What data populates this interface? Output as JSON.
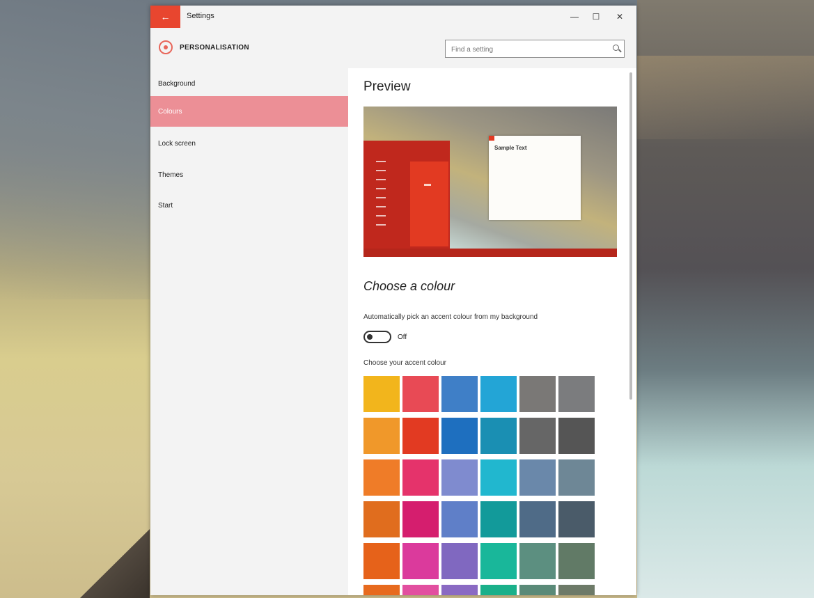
{
  "window": {
    "title": "Settings",
    "back_glyph": "←",
    "minimize_glyph": "—",
    "maximize_glyph": "☐",
    "close_glyph": "✕"
  },
  "header": {
    "section": "PERSONALISATION",
    "search_placeholder": "Find a setting",
    "icon": "gear-icon"
  },
  "sidebar": {
    "items": [
      {
        "label": "Background",
        "selected": false
      },
      {
        "label": "Colours",
        "selected": true
      },
      {
        "label": "Lock screen",
        "selected": false
      },
      {
        "label": "Themes",
        "selected": false
      },
      {
        "label": "Start",
        "selected": false
      }
    ]
  },
  "main": {
    "preview_title": "Preview",
    "preview_window_text": "Sample Text",
    "choose_title": "Choose a colour",
    "auto_label": "Automatically pick an accent colour from my background",
    "toggle_state": "Off",
    "accent_label": "Choose your accent colour",
    "accent_color": "#e23a22",
    "selected_nav_color": "#ec8f96"
  },
  "swatches": [
    "#f2b51c",
    "#e84a55",
    "#3f7fc7",
    "#23a5d6",
    "#7a7876",
    "#7b7c7e",
    "#f0982a",
    "#e23a22",
    "#1e6fbf",
    "#1a8fb3",
    "#666666",
    "#555555",
    "#ef7c28",
    "#e5336b",
    "#7f8bcf",
    "#21b7cf",
    "#6a88aa",
    "#6e8796",
    "#e06d1e",
    "#d51e6e",
    "#5f7fc8",
    "#129a9a",
    "#4f6b87",
    "#4a5b69",
    "#e6621a",
    "#db3a9c",
    "#8068c0",
    "#19b79a",
    "#5c8f80",
    "#617a66",
    "#e76a1e",
    "#e24fa0",
    "#8a6ac3",
    "#1ab08a",
    "#5a8a78",
    "#6d7a68"
  ]
}
